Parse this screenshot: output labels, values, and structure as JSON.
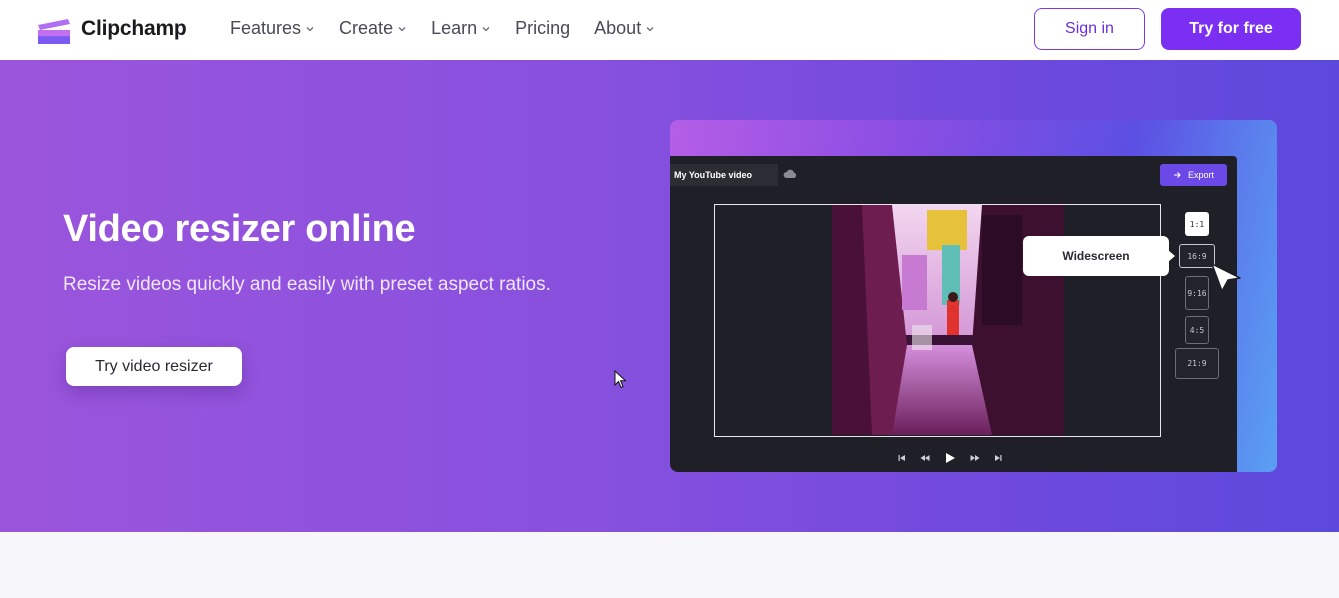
{
  "brand": {
    "name": "Clipchamp",
    "accent": "#7b2ff2"
  },
  "nav": {
    "items": [
      {
        "label": "Features",
        "has_dropdown": true
      },
      {
        "label": "Create",
        "has_dropdown": true
      },
      {
        "label": "Learn",
        "has_dropdown": true
      },
      {
        "label": "Pricing",
        "has_dropdown": false
      },
      {
        "label": "About",
        "has_dropdown": true
      }
    ],
    "sign_in": "Sign in",
    "try_free": "Try for free"
  },
  "hero": {
    "title": "Video resizer online",
    "subtitle": "Resize videos quickly and easily with preset aspect ratios.",
    "cta": "Try video resizer"
  },
  "mockup": {
    "project_name": "My YouTube video",
    "export_label": "Export",
    "tooltip": "Widescreen",
    "ratios": [
      "1:1",
      "16:9",
      "9:16",
      "4:5",
      "21:9"
    ],
    "selected_ratio": "16:9"
  }
}
